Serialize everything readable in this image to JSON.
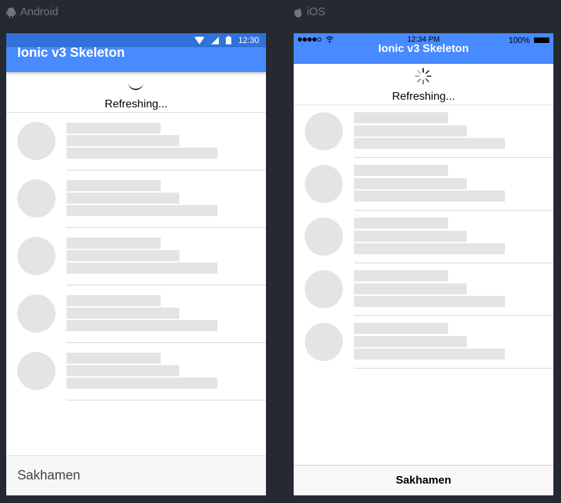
{
  "android": {
    "platform_label": "Android",
    "status_time": "12:30",
    "title": "Ionic v3 Skeleton",
    "refresh_text": "Refreshing...",
    "footer_title": "Sakhamen",
    "skeleton_item_count": 5
  },
  "ios": {
    "platform_label": "iOS",
    "status_time": "12:34 PM",
    "battery": "100%",
    "title": "Ionic v3 Skeleton",
    "refresh_text": "Refreshing...",
    "footer_title": "Sakhamen",
    "skeleton_item_count": 5
  },
  "icons": {
    "android_label": "android-icon",
    "ios_label": "apple-icon"
  },
  "colors": {
    "primary": "#488aff",
    "android_statusbar": "#3172d9",
    "skeleton": "#e4e4e4",
    "background": "#252a31"
  }
}
